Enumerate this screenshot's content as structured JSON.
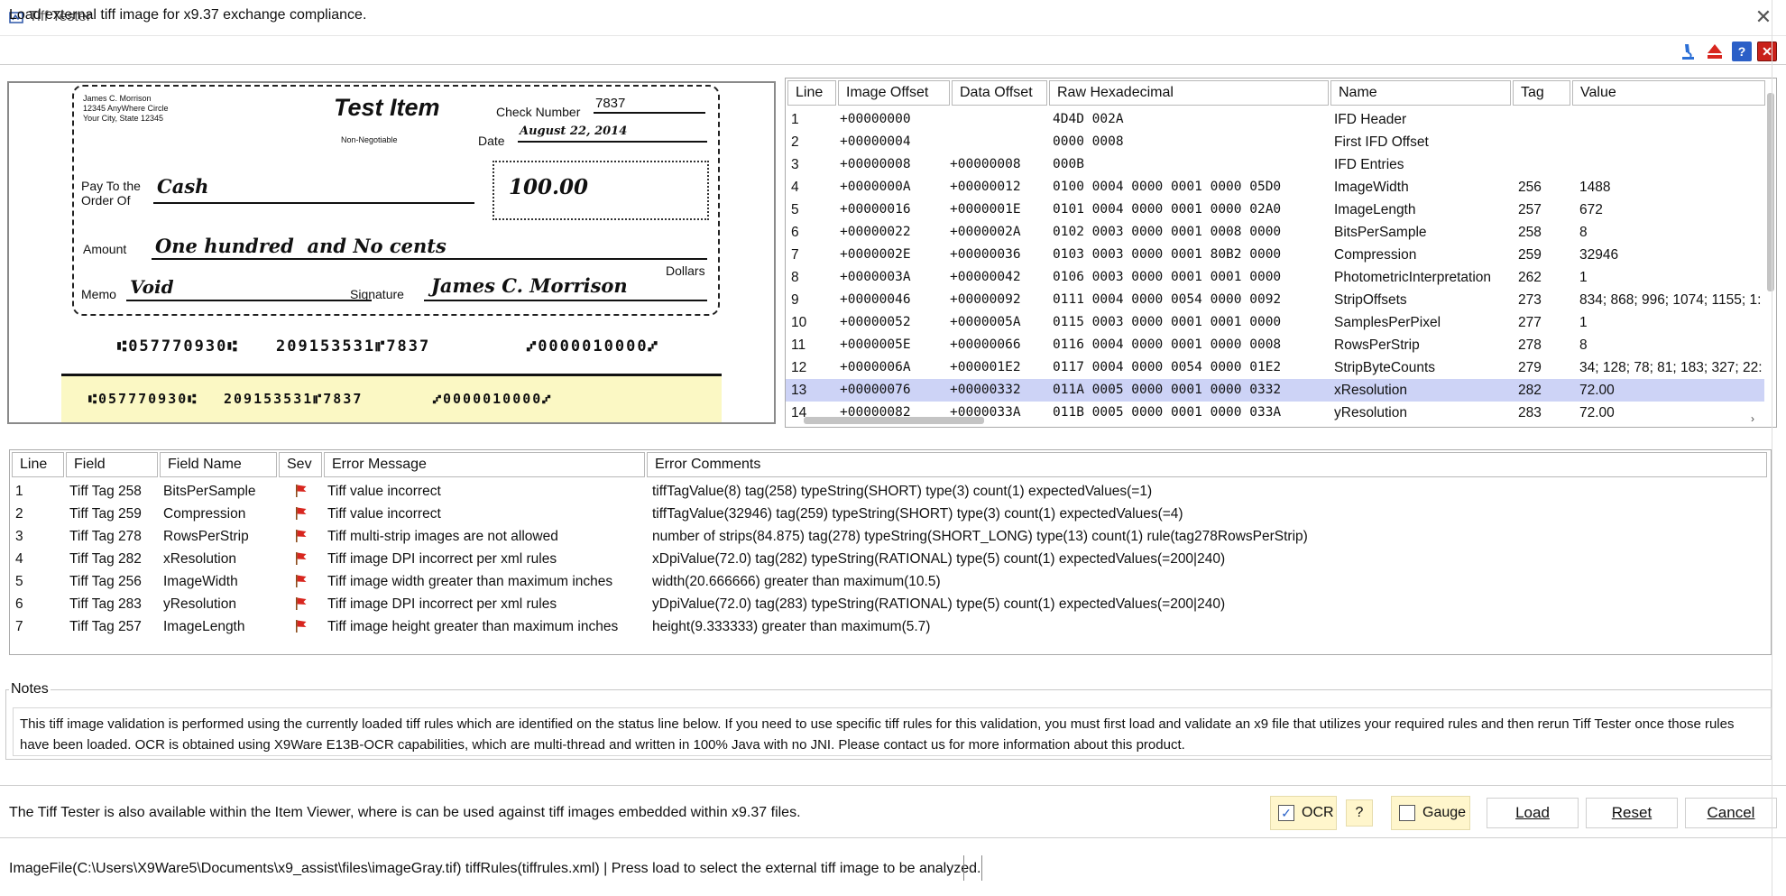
{
  "window": {
    "title": "Tiff Tester",
    "close_glyph": "✕"
  },
  "description": "Load external tiff image for x9.37 exchange compliance.",
  "toolbar_icons": [
    "microscope-icon",
    "eject-icon",
    "help-icon",
    "exit-icon"
  ],
  "check": {
    "owner_name": "James C. Morrison",
    "owner_addr1": "12345 AnyWhere Circle",
    "owner_addr2": "Your City, State 12345",
    "title": "Test Item",
    "non_negotiable": "Non-Negotiable",
    "check_number_label": "Check Number",
    "check_number": "7837",
    "date_label": "Date",
    "date": "August 22, 2014",
    "pay_to_label1": "Pay To the",
    "pay_to_label2": "Order Of",
    "payee": "Cash",
    "amount_box": "100.00",
    "amount_label": "Amount",
    "amount_words": "One hundred  and No cents",
    "dollars_label": "Dollars",
    "memo_label": "Memo",
    "memo": "Void",
    "signature_label": "Signature",
    "signature": "James C. Morrison",
    "micr_front_1": "⑆057770930⑆",
    "micr_front_2": "209153531⑈7837",
    "micr_front_3": "⑇0000010000⑇",
    "micr_back_1": "⑆057770930⑆",
    "micr_back_2": "209153531⑈7837",
    "micr_back_3": "⑇0000010000⑇"
  },
  "ifd_table": {
    "headers": [
      "Line",
      "Image Offset",
      "Data Offset",
      "Raw Hexadecimal",
      "Name",
      "Tag",
      "Value"
    ],
    "rows": [
      {
        "line": "1",
        "img": "+00000000",
        "data": "",
        "hex": "4D4D 002A",
        "name": "IFD Header",
        "tag": "",
        "value": ""
      },
      {
        "line": "2",
        "img": "+00000004",
        "data": "",
        "hex": "0000 0008",
        "name": "First IFD Offset",
        "tag": "",
        "value": ""
      },
      {
        "line": "3",
        "img": "+00000008",
        "data": "+00000008",
        "hex": "000B",
        "name": "IFD Entries",
        "tag": "",
        "value": ""
      },
      {
        "line": "4",
        "img": "+0000000A",
        "data": "+00000012",
        "hex": "0100 0004 0000 0001 0000 05D0",
        "name": "ImageWidth",
        "tag": "256",
        "value": "1488"
      },
      {
        "line": "5",
        "img": "+00000016",
        "data": "+0000001E",
        "hex": "0101 0004 0000 0001 0000 02A0",
        "name": "ImageLength",
        "tag": "257",
        "value": "672"
      },
      {
        "line": "6",
        "img": "+00000022",
        "data": "+0000002A",
        "hex": "0102 0003 0000 0001 0008 0000",
        "name": "BitsPerSample",
        "tag": "258",
        "value": "8"
      },
      {
        "line": "7",
        "img": "+0000002E",
        "data": "+00000036",
        "hex": "0103 0003 0000 0001 80B2 0000",
        "name": "Compression",
        "tag": "259",
        "value": "32946"
      },
      {
        "line": "8",
        "img": "+0000003A",
        "data": "+00000042",
        "hex": "0106 0003 0000 0001 0001 0000",
        "name": "PhotometricInterpretation",
        "tag": "262",
        "value": "1"
      },
      {
        "line": "9",
        "img": "+00000046",
        "data": "+00000092",
        "hex": "0111 0004 0000 0054 0000 0092",
        "name": "StripOffsets",
        "tag": "273",
        "value": "834; 868; 996; 1074; 1155; 1:"
      },
      {
        "line": "10",
        "img": "+00000052",
        "data": "+0000005A",
        "hex": "0115 0003 0000 0001 0001 0000",
        "name": "SamplesPerPixel",
        "tag": "277",
        "value": "1"
      },
      {
        "line": "11",
        "img": "+0000005E",
        "data": "+00000066",
        "hex": "0116 0004 0000 0001 0000 0008",
        "name": "RowsPerStrip",
        "tag": "278",
        "value": "8"
      },
      {
        "line": "12",
        "img": "+0000006A",
        "data": "+000001E2",
        "hex": "0117 0004 0000 0054 0000 01E2",
        "name": "StripByteCounts",
        "tag": "279",
        "value": "34; 128; 78; 81; 183; 327; 22:"
      },
      {
        "line": "13",
        "img": "+00000076",
        "data": "+00000332",
        "hex": "011A 0005 0000 0001 0000 0332",
        "name": "xResolution",
        "tag": "282",
        "value": "72.00"
      },
      {
        "line": "14",
        "img": "+00000082",
        "data": "+0000033A",
        "hex": "011B 0005 0000 0001 0000 033A",
        "name": "yResolution",
        "tag": "283",
        "value": "72.00"
      }
    ],
    "selected_line": "13"
  },
  "errors_table": {
    "headers": [
      "Line",
      "Field",
      "Field Name",
      "Sev",
      "Error Message",
      "Error Comments"
    ],
    "rows": [
      {
        "line": "1",
        "field": "Tiff Tag 258",
        "name": "BitsPerSample",
        "msg": "Tiff value incorrect",
        "comment": "tiffTagValue(8) tag(258) typeString(SHORT) type(3) count(1) expectedValues(=1)"
      },
      {
        "line": "2",
        "field": "Tiff Tag 259",
        "name": "Compression",
        "msg": "Tiff value incorrect",
        "comment": "tiffTagValue(32946) tag(259) typeString(SHORT) type(3) count(1) expectedValues(=4)"
      },
      {
        "line": "3",
        "field": "Tiff Tag 278",
        "name": "RowsPerStrip",
        "msg": "Tiff multi-strip images are not allowed",
        "comment": "number of strips(84.875) tag(278) typeString(SHORT_LONG) type(13) count(1) rule(tag278RowsPerStrip)"
      },
      {
        "line": "4",
        "field": "Tiff Tag 282",
        "name": "xResolution",
        "msg": "Tiff image DPI incorrect per xml rules",
        "comment": "xDpiValue(72.0) tag(282) typeString(RATIONAL) type(5) count(1) expectedValues(=200|240)"
      },
      {
        "line": "5",
        "field": "Tiff Tag 256",
        "name": "ImageWidth",
        "msg": "Tiff image width greater than maximum inches",
        "comment": "width(20.666666) greater than maximum(10.5)"
      },
      {
        "line": "6",
        "field": "Tiff Tag 283",
        "name": "yResolution",
        "msg": "Tiff image DPI incorrect per xml rules",
        "comment": "yDpiValue(72.0) tag(283) typeString(RATIONAL) type(5) count(1) expectedValues(=200|240)"
      },
      {
        "line": "7",
        "field": "Tiff Tag 257",
        "name": "ImageLength",
        "msg": "Tiff image height greater than maximum inches",
        "comment": "height(9.333333) greater than maximum(5.7)"
      }
    ]
  },
  "notes": {
    "label": "Notes",
    "text": "This tiff image validation is performed using the currently loaded tiff rules which are identified on the status line below. If you need to use specific tiff rules for this validation, you must first load and validate an x9 file that utilizes your required rules and then rerun Tiff Tester once those rules have been loaded. OCR is obtained using X9Ware E13B-OCR capabilities, which are multi-thread and written in 100% Java with no JNI. Please contact us for more information about this product."
  },
  "info_text": "The Tiff Tester is also available within the Item Viewer, where is can be used against tiff images embedded within x9.37 files.",
  "controls": {
    "ocr_label": "OCR",
    "ocr_checked": true,
    "help_label": "?",
    "gauge_label": "Gauge",
    "gauge_checked": false,
    "load_label": "Load",
    "reset_label": "Reset",
    "cancel_label": "Cancel"
  },
  "status_text": "ImageFile(C:\\Users\\X9Ware5\\Documents\\x9_assist\\files\\imageGray.tif) tiffRules(tiffrules.xml) | Press load to select the external tiff image to be analyzed.",
  "colors": {
    "selected_row": "#cdd3f6",
    "check_back": "#fbf8c4",
    "checkbox_bg": "#fff6cc",
    "flag": "#d8261f"
  }
}
